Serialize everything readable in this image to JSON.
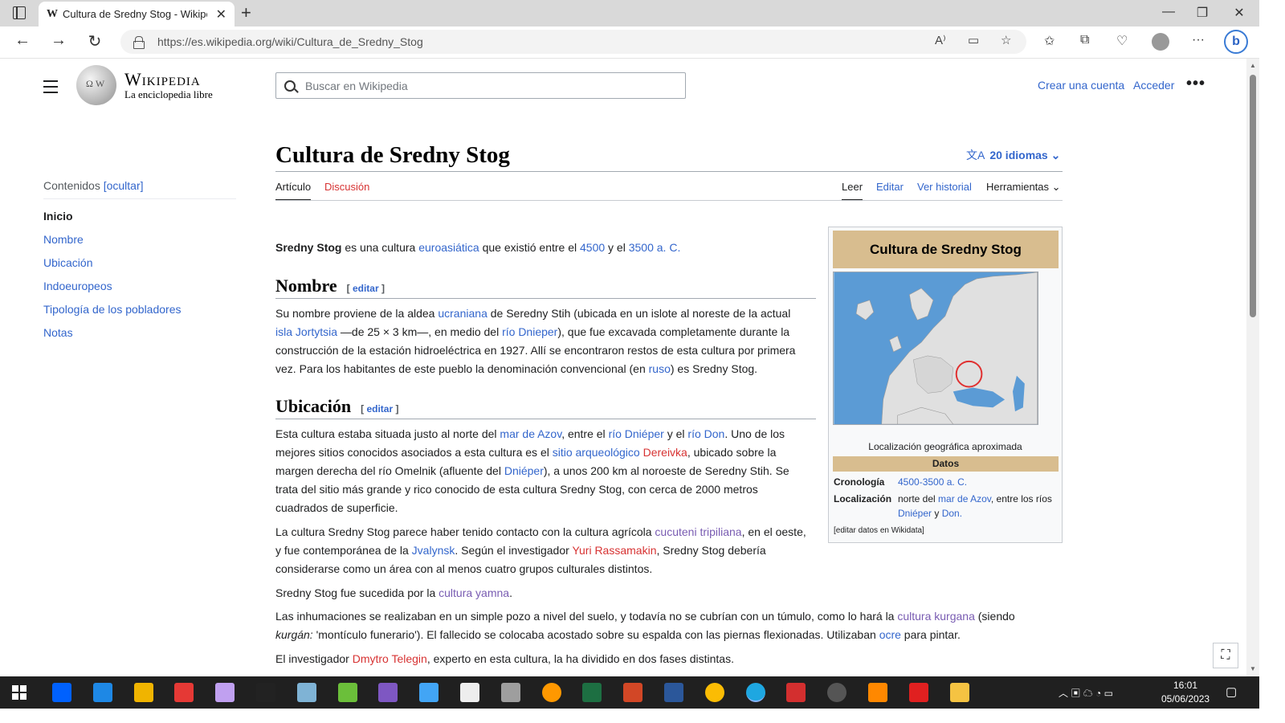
{
  "browser": {
    "tab_title": "Cultura de Sredny Stog - Wikipedia",
    "tab_favicon": "W",
    "url": "https://es.wikipedia.org/wiki/Cultura_de_Sredny_Stog",
    "icons": [
      "tab-actions-icon",
      "close-icon",
      "new-tab-icon",
      "minimize-icon",
      "restore-icon",
      "window-close-icon",
      "back-icon",
      "forward-icon",
      "refresh-icon",
      "lock-icon",
      "read-aloud-icon",
      "immersive-reader-icon",
      "favorite-star-icon",
      "favorites-icon",
      "collections-icon",
      "browser-essentials-icon",
      "profile-icon",
      "more-icon",
      "bing-icon"
    ]
  },
  "header": {
    "logo_wordmark": "Wikipedia",
    "logo_tagline": "La enciclopedia libre",
    "search_placeholder": "Buscar en Wikipedia",
    "create_account": "Crear una cuenta",
    "login": "Acceder"
  },
  "toc": {
    "heading": "Contenidos",
    "hide": "[ocultar]",
    "items": [
      "Inicio",
      "Nombre",
      "Ubicación",
      "Indoeuropeos",
      "Tipología de los pobladores",
      "Notas"
    ]
  },
  "article": {
    "title": "Cultura de Sredny Stog",
    "languages": "20 idiomas",
    "tabs": {
      "article": "Artículo",
      "talk": "Discusión",
      "read": "Leer",
      "edit": "Editar",
      "history": "Ver historial",
      "tools": "Herramientas"
    },
    "edit_label": "editar",
    "intro": {
      "bold": "Sredny Stog",
      "t1": " es una cultura ",
      "l1": "euroasiática",
      "t2": " que existió entre el ",
      "l2": "4500",
      "t3": " y el ",
      "l3": "3500 a. C."
    },
    "sections": {
      "nombre_heading": "Nombre",
      "ubicacion_heading": "Ubicación"
    },
    "nombre_p": {
      "t1": "Su nombre proviene de la aldea ",
      "l1": "ucraniana",
      "t2": " de Seredny Stih (ubicada en un islote al noreste de la actual ",
      "l2": "isla Jortytsia",
      "t3": " —de 25 × 3 km—, en medio del ",
      "l3": "río Dnieper",
      "t4": "), que fue excavada completamente durante la construcción de la estación hidroeléctrica en 1927. Allí se encontraron restos de esta cultura por primera vez. Para los habitantes de este pueblo la denominación convencional (en ",
      "l4": "ruso",
      "t5": ") es Sredny Stog."
    },
    "ubic_p1": {
      "t1": "Esta cultura estaba situada justo al norte del ",
      "l1": "mar de Azov",
      "t2": ", entre el ",
      "l2": "río Dniéper",
      "t3": " y el ",
      "l3": "río Don",
      "t4": ". Uno de los mejores sitios conocidos asociados a esta cultura es el ",
      "l4": "sitio arqueológico",
      "t5": " ",
      "l5": "Dereivka",
      "t6": ", ubicado sobre la margen derecha del río Omelnik (afluente del ",
      "l6": "Dniéper",
      "t7": "), a unos 200 km al noroeste de Seredny Stih. Se trata del sitio más grande y rico conocido de esta cultura Sredny Stog, con cerca de 2000 metros cuadrados de superficie."
    },
    "ubic_p2": {
      "t1": "La cultura Sredny Stog parece haber tenido contacto con la cultura agrícola ",
      "l1": "cucuteni tripiliana",
      "t2": ", en el oeste, y fue contemporánea de la ",
      "l2": "Jvalynsk",
      "t3": ". Según el investigador ",
      "l3": "Yuri Rassamakin",
      "t4": ", Sredny Stog debería considerarse como un área con al menos cuatro grupos culturales distintos."
    },
    "ubic_p3": {
      "t1": "Sredny Stog fue sucedida por la ",
      "l1": "cultura yamna",
      "t2": "."
    },
    "ubic_p4": {
      "t1": "Las inhumaciones se realizaban en un simple pozo a nivel del suelo, y todavía no se cubrían con un túmulo, como lo hará la ",
      "l1": "cultura kurgana",
      "t2": " (siendo ",
      "i1": "kurgán:",
      "t3": " 'montículo funerario'). El fallecido se colocaba acostado sobre su espalda con las piernas flexionadas. Utilizaban ",
      "l2": "ocre",
      "t4": " para pintar."
    },
    "ubic_p5": {
      "t1": "El investigador ",
      "l1": "Dmytro Telegin",
      "t2": ", experto en esta cultura, la ha dividido en dos fases distintas."
    }
  },
  "infobox": {
    "title": "Cultura de Sredny Stog",
    "caption": "Localización geográfica aproximada",
    "datos": "Datos",
    "cronologia_label": "Cronología",
    "cronologia_value": "4500-3500 a. C.",
    "localizacion_label": "Localización",
    "loc_t1": "norte del ",
    "loc_l1": "mar de Azov",
    "loc_t2": ", entre los ríos ",
    "loc_l2": "Dniéper",
    "loc_t3": " y ",
    "loc_l3": "Don.",
    "wikidata": "[editar datos en Wikidata]"
  },
  "taskbar": {
    "clock_time": "16:01",
    "clock_date": "05/06/2023",
    "apps": [
      "dropbox",
      "mail",
      "store",
      "app-red",
      "app-color",
      "app-s",
      "app-paint",
      "qgis",
      "app-purple",
      "app-blue",
      "app-people",
      "app-car",
      "app-ring",
      "excel",
      "powerpoint",
      "word",
      "chrome",
      "edge",
      "app-camera",
      "app-circle",
      "vlc",
      "acrobat",
      "file-explorer"
    ],
    "colors": {
      "dropbox": "#0061fe",
      "mail": "#1e88e5",
      "store": "#f0b400",
      "app-red": "#e53935",
      "app-color": "#c0a0f0",
      "app-s": "#222222",
      "app-paint": "#7fb3d5",
      "qgis": "#6bbf3a",
      "app-purple": "#7e57c2",
      "app-blue": "#42a5f5",
      "app-people": "#eeeeee",
      "app-car": "#9e9e9e",
      "app-ring": "#ff9800",
      "excel": "#1d6f42",
      "powerpoint": "#d24726",
      "word": "#2b579a",
      "chrome": "#fbbc04",
      "edge": "#1ea7e1",
      "app-camera": "#d32f2f",
      "app-circle": "#555555",
      "vlc": "#ff8800",
      "acrobat": "#e02020",
      "file-explorer": "#f5c342"
    }
  }
}
